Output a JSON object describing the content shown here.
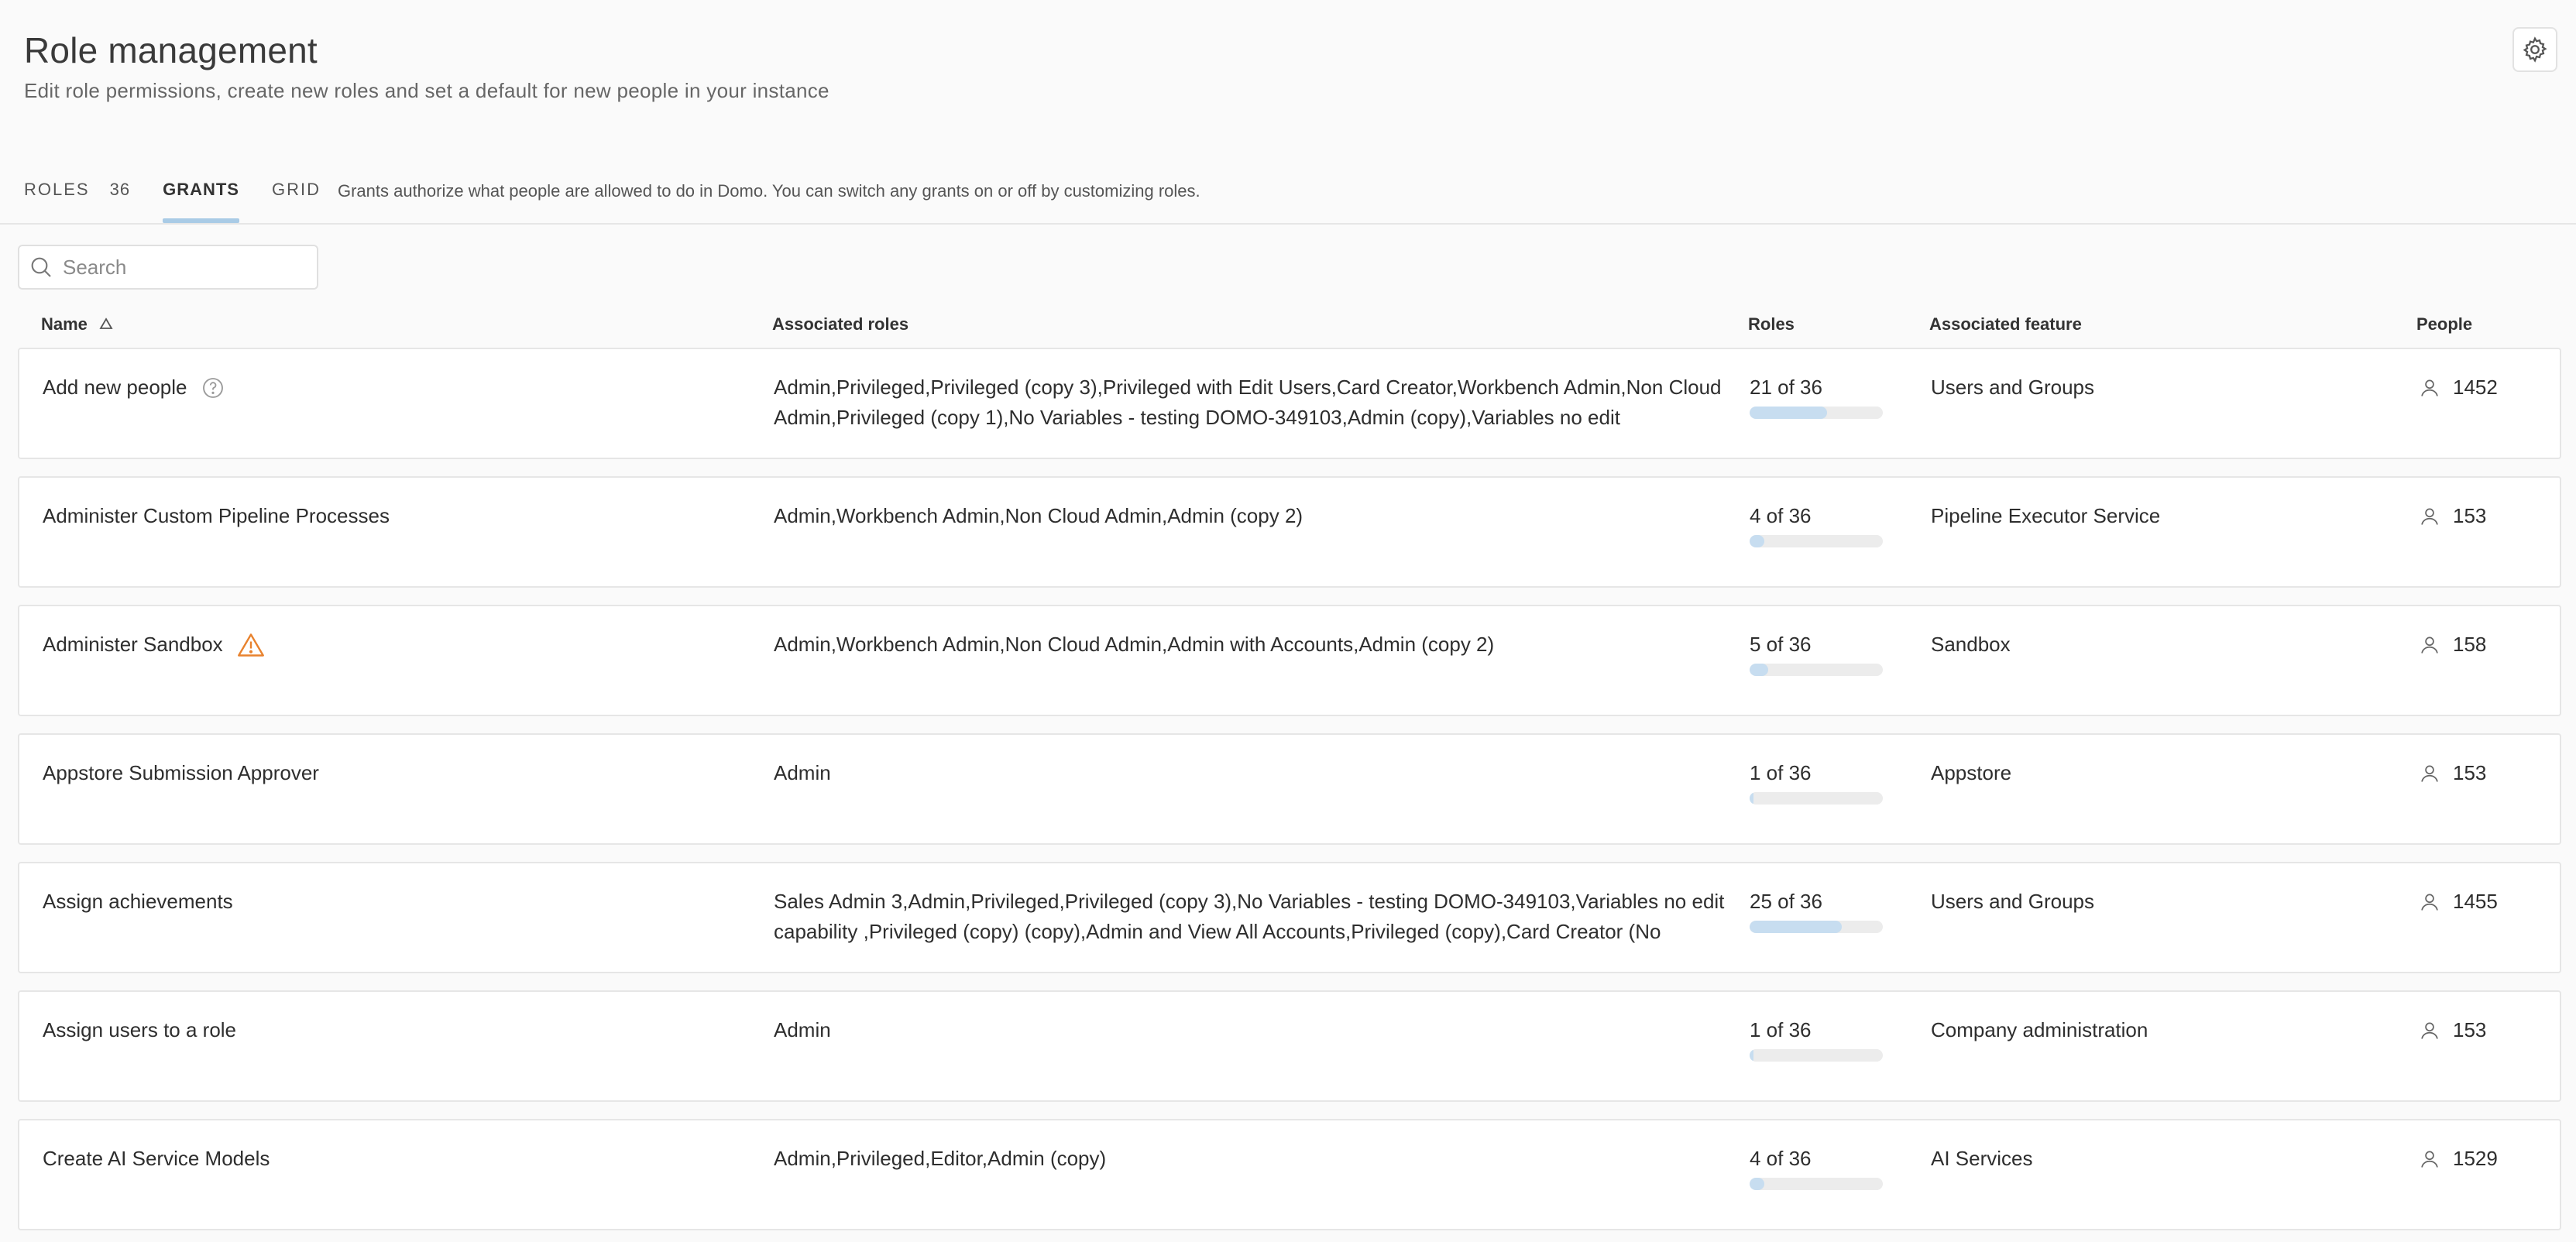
{
  "header": {
    "title": "Role management",
    "subtitle": "Edit role permissions, create new roles and set a default for new people in your instance"
  },
  "tabs": {
    "roles_label": "ROLES",
    "roles_count": "36",
    "grants_label": "GRANTS",
    "grid_label": "GRID",
    "description": "Grants authorize what people are allowed to do in Domo. You can switch any grants on or off by customizing roles."
  },
  "search": {
    "placeholder": "Search"
  },
  "columns": {
    "name": "Name",
    "associated_roles": "Associated roles",
    "roles": "Roles",
    "associated_feature": "Associated feature",
    "people": "People"
  },
  "rows": [
    {
      "name": "Add new people",
      "icon": "help-circle-icon",
      "associated_roles": "Admin,Privileged,Privileged (copy 3),Privileged with Edit Users,Card Creator,Workbench Admin,Non Cloud Admin,Privileged (copy 1),No Variables - testing DOMO-349103,Admin (copy),Variables no edit",
      "roles": "21 of 36",
      "roles_fraction": 0.583,
      "feature": "Users and Groups",
      "people": "1452"
    },
    {
      "name": "Administer Custom Pipeline Processes",
      "icon": "",
      "associated_roles": "Admin,Workbench Admin,Non Cloud Admin,Admin (copy 2)",
      "roles": "4 of 36",
      "roles_fraction": 0.111,
      "feature": "Pipeline Executor Service",
      "people": "153"
    },
    {
      "name": "Administer Sandbox",
      "icon": "warning-icon",
      "associated_roles": "Admin,Workbench Admin,Non Cloud Admin,Admin with Accounts,Admin (copy 2)",
      "roles": "5 of 36",
      "roles_fraction": 0.139,
      "feature": "Sandbox",
      "people": "158"
    },
    {
      "name": "Appstore Submission Approver",
      "icon": "",
      "associated_roles": "Admin",
      "roles": "1 of 36",
      "roles_fraction": 0.028,
      "feature": "Appstore",
      "people": "153"
    },
    {
      "name": "Assign achievements",
      "icon": "",
      "associated_roles": "Sales Admin 3,Admin,Privileged,Privileged (copy 3),No Variables - testing DOMO-349103,Variables no edit capability ,Privileged (copy) (copy),Admin and View All Accounts,Privileged (copy),Card Creator (No",
      "roles": "25 of 36",
      "roles_fraction": 0.694,
      "feature": "Users and Groups",
      "people": "1455"
    },
    {
      "name": "Assign users to a role",
      "icon": "",
      "associated_roles": "Admin",
      "roles": "1 of 36",
      "roles_fraction": 0.028,
      "feature": "Company administration",
      "people": "153"
    },
    {
      "name": "Create AI Service Models",
      "icon": "",
      "associated_roles": "Admin,Privileged,Editor,Admin (copy)",
      "roles": "4 of 36",
      "roles_fraction": 0.111,
      "feature": "AI Services",
      "people": "1529"
    }
  ],
  "colors": {
    "tab_underline": "#a9cbe6",
    "bar_fill": "#c7ddf0",
    "bar_track": "#ececec",
    "warning": "#e8822e"
  }
}
